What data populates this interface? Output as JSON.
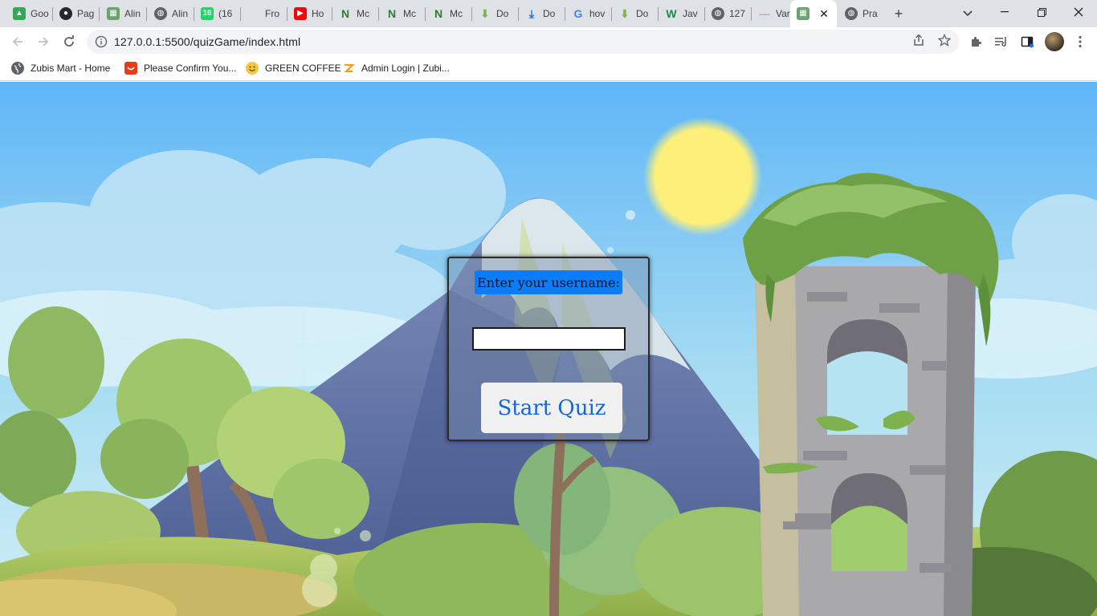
{
  "browser": {
    "tabs": [
      {
        "label": "Goo",
        "icon": "google-drive-icon",
        "color": "#34a853"
      },
      {
        "label": "Pag",
        "icon": "github-icon",
        "color": "#24292e"
      },
      {
        "label": "Alin",
        "icon": "landscape-image-icon",
        "color": "#6aa36f"
      },
      {
        "label": "Alin",
        "icon": "globe-icon",
        "color": "#5f6368"
      },
      {
        "label": "(16",
        "icon": "whatsapp-icon",
        "color": "#25d366"
      },
      {
        "label": "Fro",
        "icon": "page-icon",
        "color": "#e8eaed"
      },
      {
        "label": "Ho",
        "icon": "youtube-icon",
        "color": "#ff0000"
      },
      {
        "label": "Mc",
        "icon": "n-logo-icon",
        "color": "#2e7d32"
      },
      {
        "label": "Mc",
        "icon": "n-logo-icon",
        "color": "#2e7d32"
      },
      {
        "label": "Mc",
        "icon": "n-logo-icon",
        "color": "#2e7d32"
      },
      {
        "label": "Do",
        "icon": "download-arrow-icon",
        "color": "#7cb342"
      },
      {
        "label": "Do",
        "icon": "download-icon",
        "color": "#1a73e8"
      },
      {
        "label": "hov",
        "icon": "google-icon",
        "color": "#4285f4"
      },
      {
        "label": "Do",
        "icon": "download-arrow-icon",
        "color": "#7cb342"
      },
      {
        "label": "Jav",
        "icon": "w-logo-icon",
        "color": "#1b8c4a"
      },
      {
        "label": "127",
        "icon": "globe-icon",
        "color": "#5f6368"
      },
      {
        "label": "Var",
        "icon": "dash-icon",
        "color": "#c5a3e8"
      },
      {
        "label": "",
        "icon": "landscape-image-icon",
        "color": "#6aa36f",
        "active": true
      },
      {
        "label": "Pra",
        "icon": "globe-icon",
        "color": "#5f6368"
      }
    ],
    "new_tab_symbol": "+",
    "window_controls": {
      "minimize": "—",
      "maximize": "❐",
      "close": "✕"
    },
    "active_tab_close": "✕",
    "address": "127.0.0.1:5500/quizGame/index.html",
    "bookmarks": [
      {
        "label": "Zubis Mart - Home",
        "icon": "globe-icon"
      },
      {
        "label": "Please Confirm You...",
        "icon": "shopping-bag-icon"
      },
      {
        "label": "GREEN COFFEE",
        "icon": "smiley-icon"
      },
      {
        "label": "Admin Login | Zubi...",
        "icon": "zubi-logo-icon"
      }
    ]
  },
  "quiz": {
    "prompt": "Enter your username:",
    "username_value": "",
    "start_label": "Start Quiz"
  },
  "colors": {
    "prompt_bg": "#0d7cf9",
    "start_text": "#1565d8",
    "sky_top": "#5fb6f7",
    "sun": "#fdf07a"
  }
}
